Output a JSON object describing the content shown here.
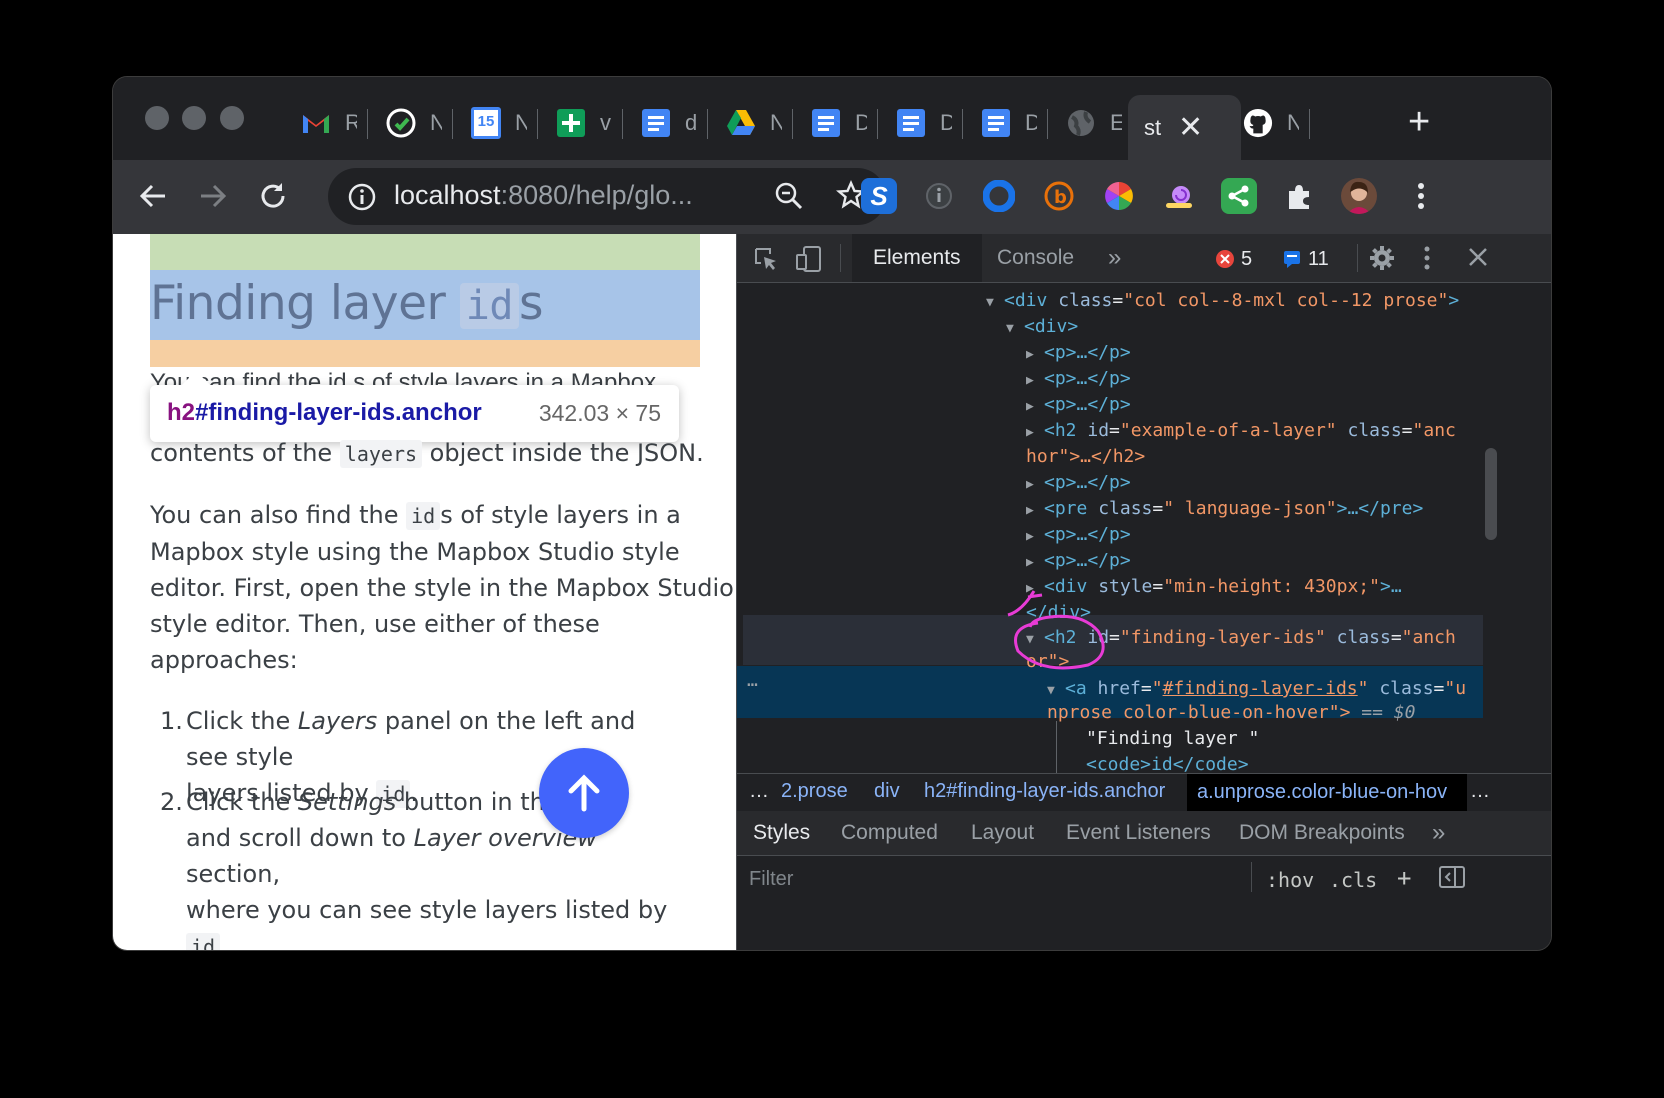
{
  "tabs": [
    {
      "icon": "gmail-icon",
      "label": "R"
    },
    {
      "icon": "github-check-icon",
      "label": "N"
    },
    {
      "icon": "calendar-icon",
      "label": "N"
    },
    {
      "icon": "sheets-plus-icon",
      "label": "v"
    },
    {
      "icon": "docs-icon",
      "label": "d"
    },
    {
      "icon": "drive-icon",
      "label": "N"
    },
    {
      "icon": "docs-icon",
      "label": "D"
    },
    {
      "icon": "docs-icon",
      "label": "D"
    },
    {
      "icon": "docs-icon",
      "label": "D"
    },
    {
      "icon": "globe-icon",
      "label": "E"
    },
    {
      "icon": "active-tab",
      "label": "st"
    },
    {
      "icon": "github-icon",
      "label": "N"
    }
  ],
  "calendar_day": "15",
  "toolbar": {
    "url_host": "localhost",
    "url_rest": ":8080/help/glo..."
  },
  "page": {
    "heading_text": "Finding layer ",
    "heading_code": "id",
    "heading_suffix": "s",
    "behind_text": "You can find the id s of style layers in a Mapbox",
    "tooltip_tag": "h2",
    "tooltip_rest": "#finding-layer-ids.anchor",
    "tooltip_dims": "342.03 × 75",
    "p1_before": "contents of the ",
    "p1_code": "layers",
    "p1_after": " object inside the JSON.",
    "p2_l1_before": "You can also find the ",
    "p2_l1_code": "id",
    "p2_l1_after": "s of style layers in a",
    "p2_l2": "Mapbox style using the Mapbox Studio style",
    "p2_l3": "editor. First, open the style in the Mapbox Studio",
    "p2_l4": "style editor. Then, use either of these",
    "p2_l5": "approaches:",
    "li1_num": "1.",
    "li1_a": "Click the ",
    "li1_em": "Layers",
    "li1_b": " panel on the left and see style",
    "li1_c": "layers listed by ",
    "li1_code": "id",
    "li1_d": ".",
    "li2_num": "2.",
    "li2_a": "Click the ",
    "li2_em": "Settings",
    "li2_b": " button in the top",
    "li2_c": "and scroll down to ",
    "li2_em2": "Layer overview",
    "li2_d": " section,",
    "li2_e": "where you can see style layers listed by ",
    "li2_code": "id",
    "li2_f": "."
  },
  "devtools": {
    "tabs": [
      "Elements",
      "Console"
    ],
    "more": "»",
    "errors": "5",
    "messages": "11",
    "dom": {
      "l1_tag": "<div",
      "l1_attr": "class",
      "l1_val": "\"col col--8-mxl col--12 prose\"",
      "l2": "<div>",
      "p": "<p>…</p>",
      "h2a_open": "<h2",
      "h2a_id_attr": "id",
      "h2a_id_val": "\"example-of-a-layer\"",
      "h2a_class_attr": "class",
      "h2a_class_val": "\"anc",
      "h2a_cont": "hor\">…</h2>",
      "pre_open": "<pre",
      "pre_attr": "class",
      "pre_val": "\" language-json\"",
      "pre_close": ">…</pre>",
      "div_open": "<div",
      "div_attr": "style",
      "div_val": "\"min-height: 430px;\"",
      "div_close": ">…",
      "div_end": "</div>",
      "h2b_open": "<h2",
      "h2b_id_attr": "id",
      "h2b_id_val": "\"finding-layer-ids\"",
      "h2b_class_attr": "class",
      "h2b_class_val": "\"anch",
      "h2b_cont": "or\">",
      "a_open": "<a",
      "a_href_attr": "href",
      "a_href_val": "#finding-layer-ids",
      "a_class_attr": "class",
      "a_class_val": "\"u",
      "a_cont": "nprose color-blue-on-hover\">",
      "a_eq": " == $0",
      "text_node": "\"Finding layer \"",
      "code_line": "<code>id</code>",
      "ellipsis": "…"
    },
    "breadcrumbs": [
      "…",
      "2.prose",
      "div",
      "h2#finding-layer-ids.anchor",
      "a.unprose.color-blue-on-hov",
      "…"
    ],
    "subtabs": [
      "Styles",
      "Computed",
      "Layout",
      "Event Listeners",
      "DOM Breakpoints",
      "»"
    ],
    "filter_placeholder": "Filter",
    "hov": ":hov",
    "cls": ".cls",
    "plus": "+"
  },
  "colors": {
    "accent_blue": "#4264fb",
    "annotation_magenta": "#e83bd6"
  }
}
